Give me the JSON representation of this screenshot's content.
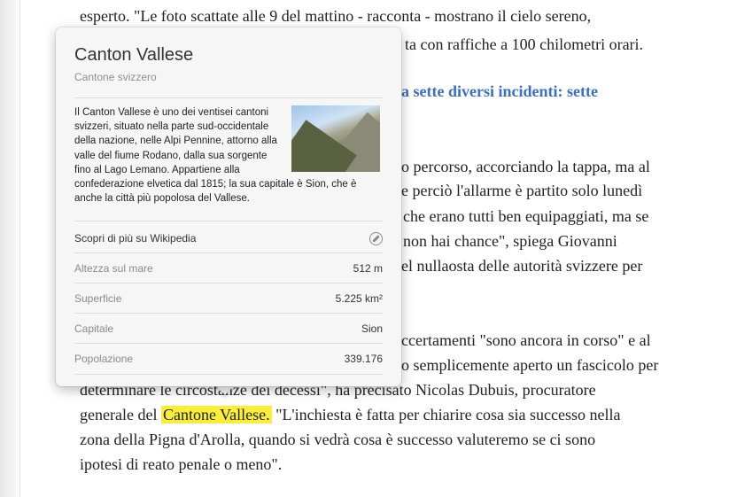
{
  "article": {
    "lines": [
      "esperto. \"Le foto scattate alle 9 del mattino - racconta - mostrano il cielo sereno,",
      "ta con raffiche a 100 chilometri orari.",
      "o percorso, accorciando la tappa, ma al",
      "e perciò l'allarme è partito solo lunedì",
      "che erano tutti ben equipaggiati, ma se",
      "non hai chance\", spiega Giovanni",
      "el nullaosta delle autorità svizzere per",
      "ccertamenti \"sono ancora in corso\" e al",
      "o semplicemente aperto un fascicolo per",
      "determinare le circostanze dei decessi\", ha precisato Nicolas Dubuis, procuratore",
      "zona della Pigna d'Arolla, quando si vedrà cosa è successo valuteremo se ci sono",
      "ipotesi di reato penale o meno\"."
    ],
    "subheading_fragment": "a sette diversi incidenti: sette",
    "subheading_fragment_2": "",
    "line_generale_prefix": "generale del",
    "highlight": "Cantone Vallese.",
    "line_generale_suffix": "\"L'inchiesta è fatta per chiarire cosa sia successo nella"
  },
  "popover": {
    "title": "Canton Vallese",
    "subtitle": "Cantone svizzero",
    "description": "Il Canton Vallese è uno dei ventisei cantoni svizzeri, situato nella parte sud-occidentale della nazione, nelle Alpi Pennine, attorno alla valle del fiume Rodano, dalla sua sorgente fino al Lago Lemano. Appartiene alla confederazione elvetica dal 1815; la sua capitale è Sion, che è anche la città più popolosa del Vallese.",
    "wiki_link": "Scopri di più su Wikipedia",
    "facts": [
      {
        "label": "Altezza sul mare",
        "value": "512 m"
      },
      {
        "label": "Superficie",
        "value": "5.225 km²"
      },
      {
        "label": "Capitale",
        "value": "Sion"
      },
      {
        "label": "Popolazione",
        "value": "339.176"
      }
    ]
  },
  "icons": {
    "wiki": "compass-icon",
    "thumbnail": "valley-photo"
  }
}
